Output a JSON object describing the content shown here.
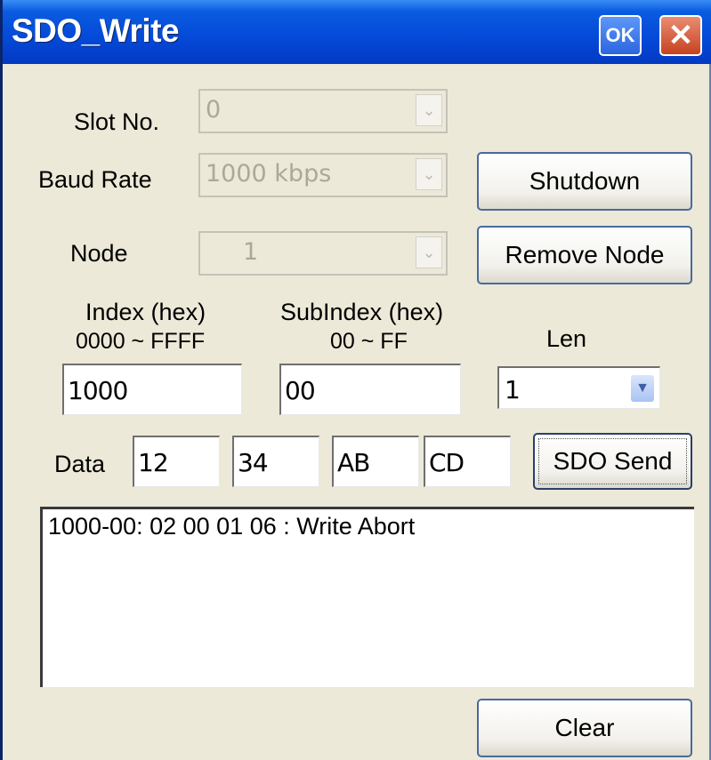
{
  "window": {
    "title": "SDO_Write",
    "ok_label": "OK",
    "close_label": "✕"
  },
  "slot": {
    "label": "Slot No.",
    "value": "0"
  },
  "baud": {
    "label": "Baud Rate",
    "value": "1000 kbps"
  },
  "node": {
    "label": "Node",
    "value": "1"
  },
  "buttons": {
    "shutdown": "Shutdown",
    "remove_node": "Remove Node",
    "sdo_send": "SDO Send",
    "clear": "Clear"
  },
  "index": {
    "label_line1": "Index (hex)",
    "label_line2": "0000 ~ FFFF",
    "value": "1000"
  },
  "subindex": {
    "label_line1": "SubIndex (hex)",
    "label_line2": "00 ~ FF",
    "value": "00"
  },
  "len": {
    "label": "Len",
    "value": "1"
  },
  "data": {
    "label": "Data",
    "values": [
      "12",
      "34",
      "AB",
      "CD"
    ]
  },
  "log": {
    "lines": [
      "1000-00: 02 00 01 06 : Write Abort"
    ]
  },
  "colors": {
    "titlebar": "#0449d8",
    "dialog_bg": "#ece9d8",
    "close_button": "#c6431f",
    "ok_button": "#2c65e0"
  },
  "icons": {
    "dropdown": "chevron-down-icon"
  }
}
